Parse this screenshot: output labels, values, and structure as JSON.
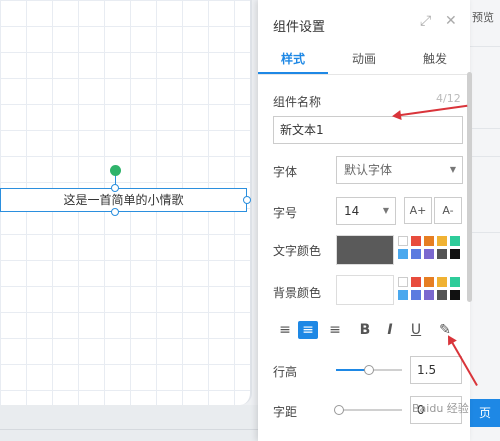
{
  "canvas": {
    "text_element": "这是一首简单的小情歌"
  },
  "panel": {
    "title": "组件设置",
    "tabs": [
      {
        "label": "样式"
      },
      {
        "label": "动画"
      },
      {
        "label": "触发"
      }
    ],
    "name": {
      "label": "组件名称",
      "count": "4/12",
      "value": "新文本1"
    },
    "font": {
      "label": "字体",
      "value": "默认字体"
    },
    "size": {
      "label": "字号",
      "value": "14",
      "increase": "A+",
      "decrease": "A-"
    },
    "text_color": {
      "label": "文字颜色",
      "current": "#5a5a5a"
    },
    "bg_color": {
      "label": "背景颜色",
      "current": "#ffffff"
    },
    "palette": [
      "#ffffff",
      "#e84c3d",
      "#e67e22",
      "#f0b233",
      "#2ecc9a",
      "#4aa8ee",
      "#5b7be0",
      "#7b68cf",
      "#555555",
      "#111111"
    ],
    "format_icons": [
      "align-left-icon",
      "align-center-icon",
      "align-right-icon",
      "bold-icon",
      "italic-icon",
      "underline-icon",
      "brush-icon"
    ],
    "format_glyphs": {
      "bold": "B",
      "italic": "I",
      "underline": "U"
    },
    "line_height": {
      "label": "行高",
      "value": "1.5",
      "slider_fraction": 0.5
    },
    "letter_spacing": {
      "label": "字距",
      "value": "0",
      "slider_fraction": 0.0
    }
  },
  "right_strip": {
    "label": "预览",
    "button_label": "页"
  },
  "watermark": "Baidu 经验",
  "colors": {
    "accent": "#1e88e5",
    "annotation_arrow": "#d9343a",
    "rotate_handle": "#2fb36b"
  }
}
